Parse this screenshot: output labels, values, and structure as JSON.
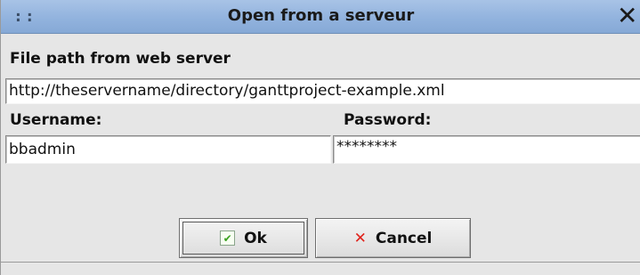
{
  "window": {
    "title": "Open from a serveur",
    "grip_glyph": "::",
    "close_glyph": "✕"
  },
  "form": {
    "file_path_label": "File path from web server",
    "file_path_value": "http://theservername/directory/ganttproject-example.xml",
    "username_label": "Username:",
    "username_value": "bbadmin",
    "password_label": "Password:",
    "password_value": "********"
  },
  "buttons": {
    "ok_label": "Ok",
    "cancel_label": "Cancel"
  },
  "icons": {
    "ok_icon": "check-icon",
    "cancel_icon": "x-icon"
  },
  "colors": {
    "titlebar": "#92b3de",
    "ok_icon": "#3aa11f",
    "cancel_icon": "#e0231c"
  }
}
